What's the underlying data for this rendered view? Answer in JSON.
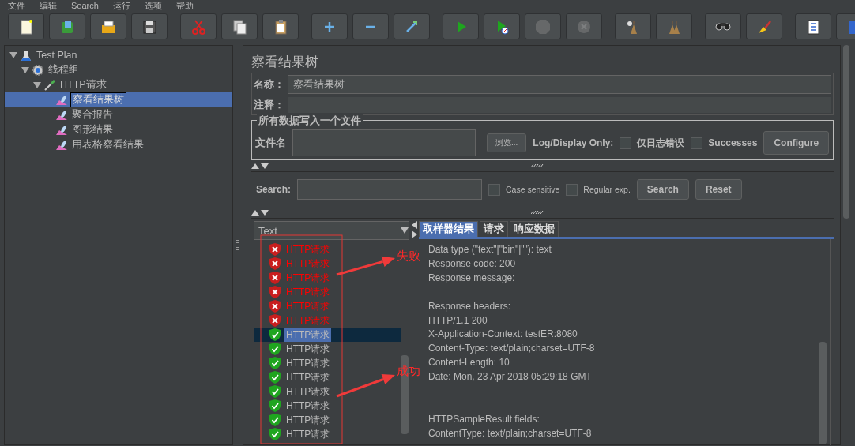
{
  "menu": [
    "文件",
    "编辑",
    "Search",
    "运行",
    "选项",
    "帮助"
  ],
  "toolbar": [
    {
      "buttons": [
        {
          "kind": "new",
          "disabled": false
        },
        {
          "kind": "templates",
          "disabled": false
        },
        {
          "kind": "open",
          "disabled": false
        },
        {
          "kind": "save",
          "disabled": false
        }
      ]
    },
    {
      "buttons": [
        {
          "kind": "cut",
          "disabled": false
        },
        {
          "kind": "copy",
          "disabled": false
        },
        {
          "kind": "paste",
          "disabled": false
        }
      ]
    },
    {
      "buttons": [
        {
          "kind": "expand",
          "disabled": false
        },
        {
          "kind": "collapse",
          "disabled": false
        },
        {
          "kind": "toggle",
          "disabled": false
        }
      ]
    },
    {
      "buttons": [
        {
          "kind": "start",
          "disabled": false
        },
        {
          "kind": "start-no-pause",
          "disabled": false
        },
        {
          "kind": "stop",
          "disabled": true
        },
        {
          "kind": "shutdown",
          "disabled": true
        }
      ]
    },
    {
      "buttons": [
        {
          "kind": "clear",
          "disabled": false
        },
        {
          "kind": "clear-all",
          "disabled": false
        }
      ]
    },
    {
      "buttons": [
        {
          "kind": "search",
          "disabled": false
        },
        {
          "kind": "reset",
          "disabled": false
        }
      ]
    },
    {
      "buttons": [
        {
          "kind": "function",
          "disabled": false
        },
        {
          "kind": "help",
          "disabled": false
        }
      ]
    }
  ],
  "tree": [
    {
      "label": "Test Plan",
      "kind": "plan",
      "selected": false,
      "expanded": true,
      "children": [
        {
          "label": "线程组",
          "kind": "threads",
          "selected": false,
          "expanded": true,
          "children": [
            {
              "label": "HTTP请求",
              "kind": "sampler",
              "selected": false,
              "expanded": true,
              "children": [
                {
                  "label": "察看结果树",
                  "kind": "listener",
                  "selected": true
                },
                {
                  "label": "聚合报告",
                  "kind": "listener",
                  "selected": false
                },
                {
                  "label": "图形结果",
                  "kind": "listener",
                  "selected": false
                },
                {
                  "label": "用表格察看结果",
                  "kind": "listener",
                  "selected": false
                }
              ]
            }
          ]
        }
      ]
    }
  ],
  "panel": {
    "title": "察看结果树",
    "name_label": "名称：",
    "name_value": "察看结果树",
    "comment_label": "注释：",
    "file_group": {
      "legend": "所有数据写入一个文件",
      "file_label": "文件名",
      "browse_button": "浏览...",
      "log_label": "Log/Display Only:",
      "checkboxes": [
        {
          "label": "仅日志错误",
          "checked": false
        },
        {
          "label": "Successes",
          "checked": false
        }
      ],
      "configure_button": "Configure"
    },
    "search": {
      "label": "Search:",
      "checkboxes": [
        {
          "label": "Case sensitive",
          "checked": false
        },
        {
          "label": "Regular exp.",
          "checked": false
        }
      ],
      "buttons": [
        "Search",
        "Reset"
      ]
    },
    "results": {
      "renderer": "Text",
      "rows": [
        {
          "label": "HTTP请求",
          "kind": "fail",
          "selected": false
        },
        {
          "label": "HTTP请求",
          "kind": "fail",
          "selected": false
        },
        {
          "label": "HTTP请求",
          "kind": "fail",
          "selected": false
        },
        {
          "label": "HTTP请求",
          "kind": "fail",
          "selected": false
        },
        {
          "label": "HTTP请求",
          "kind": "fail",
          "selected": false
        },
        {
          "label": "HTTP请求",
          "kind": "fail",
          "selected": false
        },
        {
          "label": "HTTP请求",
          "kind": "ok",
          "selected": true
        },
        {
          "label": "HTTP请求",
          "kind": "ok",
          "selected": false
        },
        {
          "label": "HTTP请求",
          "kind": "ok",
          "selected": false
        },
        {
          "label": "HTTP请求",
          "kind": "ok",
          "selected": false
        },
        {
          "label": "HTTP请求",
          "kind": "ok",
          "selected": false
        },
        {
          "label": "HTTP请求",
          "kind": "ok",
          "selected": false
        },
        {
          "label": "HTTP请求",
          "kind": "ok",
          "selected": false
        },
        {
          "label": "HTTP请求",
          "kind": "ok",
          "selected": false
        }
      ]
    },
    "tabs": [
      {
        "label": "取样器结果",
        "selected": true
      },
      {
        "label": "请求",
        "selected": false
      },
      {
        "label": "响应数据",
        "selected": false
      }
    ],
    "response_blocks": [
      {
        "kind": "top",
        "lines": [
          "Data type (\"text\"|\"bin\"|\"\"): text",
          "Response code: 200",
          "Response message:"
        ]
      },
      {
        "kind": "single",
        "lines": [
          "Response headers:",
          "HTTP/1.1 200",
          "X-Application-Context: testER:8080",
          "Content-Type: text/plain;charset=UTF-8",
          "Content-Length: 10",
          "Date: Mon, 23 Apr 2018 05:29:18 GMT"
        ]
      },
      {
        "kind": "double",
        "lines": [
          "HTTPSampleResult fields:",
          "ContentType: text/plain;charset=UTF-8"
        ]
      }
    ]
  },
  "annotations": [
    {
      "text": "失败"
    },
    {
      "text": "成功"
    }
  ]
}
